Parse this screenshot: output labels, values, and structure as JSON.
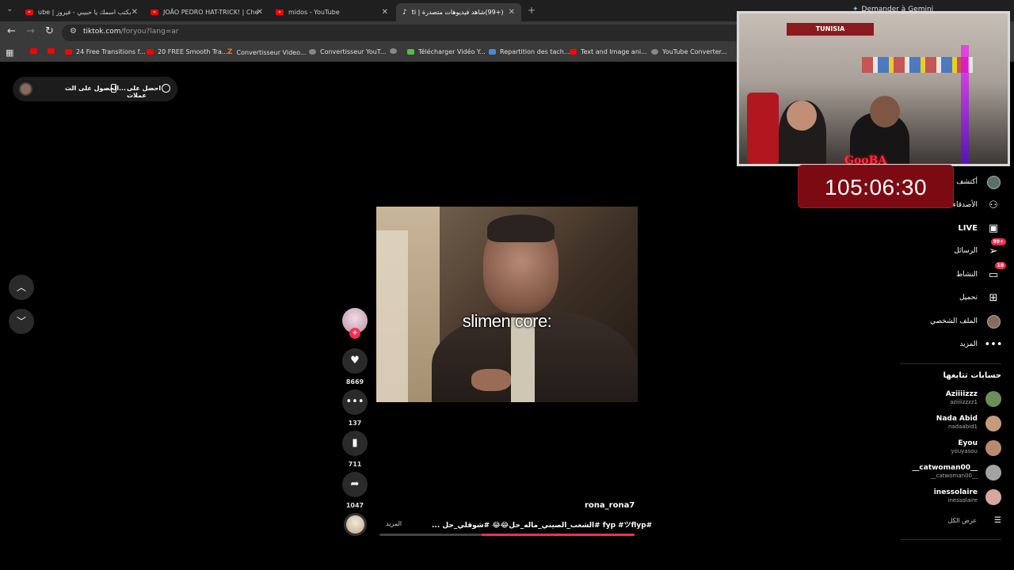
{
  "browser": {
    "tabs": [
      {
        "title": "ube | بكتب اسمك يا حبيبي - فيروز"
      },
      {
        "title": "JOÃO PEDRO HAT-TRICK! | Che"
      },
      {
        "title": "midos - YouTube"
      },
      {
        "title": "(+99)شاهد فيديوهات متصدرة | ti"
      }
    ],
    "new_tab": "+",
    "url_domain": "tiktok.com",
    "url_path": "/foryou?lang=ar",
    "bookmarks": [
      {
        "label": "",
        "icon": "youtube-icon"
      },
      {
        "label": "",
        "icon": "youtube-icon"
      },
      {
        "label": "24 Free Transitions f...",
        "icon": "youtube-icon"
      },
      {
        "label": "20 FREE Smooth Tra...",
        "icon": "youtube-icon"
      },
      {
        "label": "Convertisseur Video...",
        "icon": "z-icon"
      },
      {
        "label": "Convertisseur YouT...",
        "icon": "convert-icon"
      },
      {
        "label": "",
        "icon": "globe-icon"
      },
      {
        "label": "Télécharger Vidéo Y...",
        "icon": "download-icon"
      },
      {
        "label": "Repartition des tach...",
        "icon": "docs-icon"
      },
      {
        "label": "Text and Image ani...",
        "icon": "youtube-icon"
      },
      {
        "label": "YouTube Converter...",
        "icon": "globe-icon"
      }
    ],
    "gemini": "Demander à Gemini"
  },
  "top_pill": {
    "get_app": "الحصول على الت...",
    "get_coins": "احصل على عملات"
  },
  "video": {
    "caption": "slimen core:",
    "username": "rona_rona7",
    "description": "#fyp #ツflyp #الشعب_الصيني_ماله_حل😂😂 #شوقلي_حل ...",
    "more": "المزيد",
    "progress": 0.6
  },
  "actions": {
    "likes": "8669",
    "comments": "137",
    "saves": "711",
    "shares": "1047"
  },
  "overlay": {
    "timer": "105:06:30",
    "stream_banner": "TUNISIA",
    "stream_logo": "GooBA"
  },
  "sidebar": {
    "nav": [
      {
        "label": "أكتشف",
        "icon": "explore-icon",
        "badge": ""
      },
      {
        "label": "الأصدقاء",
        "icon": "friends-icon",
        "badge": ""
      },
      {
        "label": "LIVE",
        "icon": "live-icon",
        "badge": ""
      },
      {
        "label": "الرسائل",
        "icon": "messages-icon",
        "badge": "99+"
      },
      {
        "label": "النشاط",
        "icon": "activity-icon",
        "badge": "18"
      },
      {
        "label": "تحميل",
        "icon": "upload-icon",
        "badge": ""
      },
      {
        "label": "الملف الشخصي",
        "icon": "profile-icon",
        "badge": ""
      },
      {
        "label": "المزيد",
        "icon": "more-icon",
        "badge": ""
      }
    ],
    "following_title": "حسابات تتابعها",
    "following": [
      {
        "name": "Aziiiizzz",
        "handle": "aziiiizzzz1",
        "color": "#6b8f5a"
      },
      {
        "name": "Nada Abid",
        "handle": "nadaabid1",
        "color": "#c79a7e"
      },
      {
        "name": "Eyou",
        "handle": "youyasou",
        "color": "#b98b6e"
      },
      {
        "name": "__catwoman00__",
        "handle": "__catwoman00__",
        "color": "#a3a3a3"
      },
      {
        "name": "inessolaire",
        "handle": "inessolaire",
        "color": "#d4a9a0"
      }
    ],
    "see_all": "عرض الكل"
  },
  "colors": {
    "accent": "#fe2c55",
    "timer_bg": "#7c0a12"
  }
}
